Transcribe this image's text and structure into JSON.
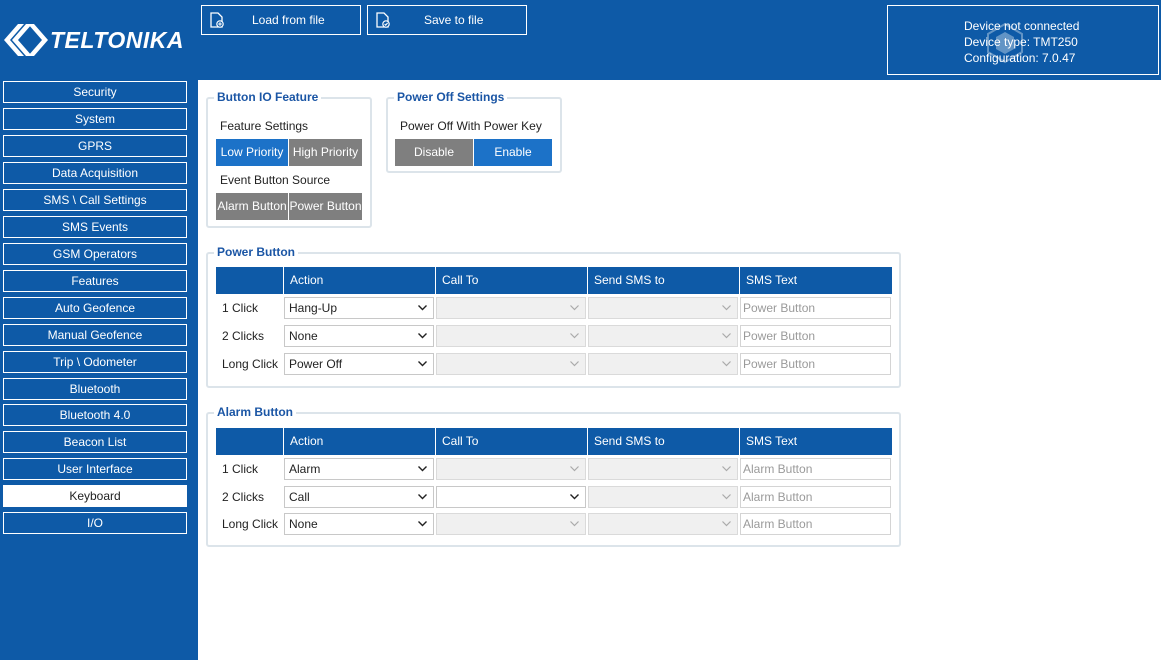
{
  "header": {
    "logo_text": "TELTONIKA",
    "load_label": "Load from file",
    "save_label": "Save to file",
    "device_status": "Device not connected",
    "device_type": "Device type: TMT250",
    "configuration": "Configuration: 7.0.47"
  },
  "sidebar": {
    "items": [
      {
        "label": "Security"
      },
      {
        "label": "System"
      },
      {
        "label": "GPRS"
      },
      {
        "label": "Data Acquisition"
      },
      {
        "label": "SMS \\ Call Settings"
      },
      {
        "label": "SMS Events"
      },
      {
        "label": "GSM Operators"
      },
      {
        "label": "Features"
      },
      {
        "label": "Auto Geofence"
      },
      {
        "label": "Manual Geofence"
      },
      {
        "label": "Trip \\ Odometer"
      },
      {
        "label": "Bluetooth"
      },
      {
        "label": "Bluetooth 4.0"
      },
      {
        "label": "Beacon List"
      },
      {
        "label": "User Interface"
      },
      {
        "label": "Keyboard"
      },
      {
        "label": "I/O"
      }
    ],
    "active": "Keyboard"
  },
  "button_io": {
    "title": "Button IO Feature",
    "feature_settings_label": "Feature Settings",
    "feature_options": [
      "Low Priority",
      "High Priority"
    ],
    "feature_selected": "Low Priority",
    "event_source_label": "Event Button Source",
    "source_options": [
      "Alarm Button",
      "Power Button"
    ],
    "source_selected": null
  },
  "power_off": {
    "title": "Power Off Settings",
    "label": "Power Off With Power Key",
    "options": [
      "Disable",
      "Enable"
    ],
    "selected": "Enable"
  },
  "columns": [
    "Action",
    "Call To",
    "Send SMS to",
    "SMS Text"
  ],
  "power_button": {
    "title": "Power Button",
    "rows": [
      {
        "label": "1 Click",
        "action": "Hang-Up",
        "call_to": "",
        "call_to_enabled": false,
        "sms_to": "",
        "sms_text": "Power Button"
      },
      {
        "label": "2 Clicks",
        "action": "None",
        "call_to": "",
        "call_to_enabled": false,
        "sms_to": "",
        "sms_text": "Power Button"
      },
      {
        "label": "Long Click",
        "action": "Power Off",
        "call_to": "",
        "call_to_enabled": false,
        "sms_to": "",
        "sms_text": "Power Button"
      }
    ]
  },
  "alarm_button": {
    "title": "Alarm Button",
    "rows": [
      {
        "label": "1 Click",
        "action": "Alarm",
        "call_to": "",
        "call_to_enabled": false,
        "sms_to": "",
        "sms_text": "Alarm Button"
      },
      {
        "label": "2 Clicks",
        "action": "Call",
        "call_to": "",
        "call_to_enabled": true,
        "sms_to": "",
        "sms_text": "Alarm Button"
      },
      {
        "label": "Long Click",
        "action": "None",
        "call_to": "",
        "call_to_enabled": false,
        "sms_to": "",
        "sms_text": "Alarm Button"
      }
    ]
  },
  "colors": {
    "brand_blue": "#0e5aa7",
    "selected_blue": "#1c72c8",
    "unselected_gray": "#7f7f7f",
    "legend_blue": "#1b56a5"
  }
}
